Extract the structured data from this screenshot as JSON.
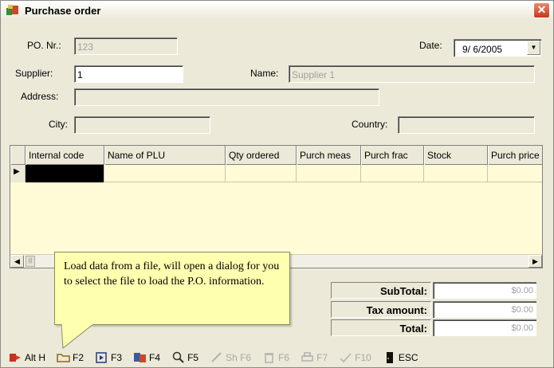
{
  "window": {
    "title": "Purchase order"
  },
  "form": {
    "po_label": "PO. Nr.:",
    "po_value": "123",
    "date_label": "Date:",
    "date_value": "9/ 6/2005",
    "supplier_label": "Supplier:",
    "supplier_value": "1",
    "name_label": "Name:",
    "name_value": "Supplier 1",
    "address_label": "Address:",
    "address_value": "",
    "city_label": "City:",
    "city_value": "",
    "country_label": "Country:",
    "country_value": ""
  },
  "grid": {
    "columns": [
      "Internal code",
      "Name of PLU",
      "Qty ordered",
      "Purch meas",
      "Purch frac",
      "Stock",
      "Purch price"
    ]
  },
  "totals": {
    "subtotal_label": "SubTotal:",
    "subtotal_value": "$0.00",
    "tax_label": "Tax amount:",
    "tax_value": "$0.00",
    "total_label": "Total:",
    "total_value": "$0.00"
  },
  "tooltip": {
    "text": "Load data from a file, will open a dialog for you to select the file to load the P.O. information."
  },
  "toolbar": {
    "items": [
      {
        "label": "Alt H",
        "icon": "exit-icon",
        "enabled": true
      },
      {
        "label": "F2",
        "icon": "open-folder-icon",
        "enabled": true
      },
      {
        "label": "F3",
        "icon": "play-icon",
        "enabled": true
      },
      {
        "label": "F4",
        "icon": "export-icon",
        "enabled": true
      },
      {
        "label": "F5",
        "icon": "zoom-icon",
        "enabled": true
      },
      {
        "label": "Sh F6",
        "icon": "edit-icon",
        "enabled": false
      },
      {
        "label": "F6",
        "icon": "trash-icon",
        "enabled": false
      },
      {
        "label": "F7",
        "icon": "print-icon",
        "enabled": false
      },
      {
        "label": "F10",
        "icon": "check-icon",
        "enabled": false
      },
      {
        "label": "ESC",
        "icon": "door-icon",
        "enabled": true
      }
    ]
  },
  "colors": {
    "grid_bg": "#fffbd6",
    "tooltip_bg": "#ffffb0",
    "window_bg": "#ece9d8",
    "close_btn": "#c8381c"
  }
}
